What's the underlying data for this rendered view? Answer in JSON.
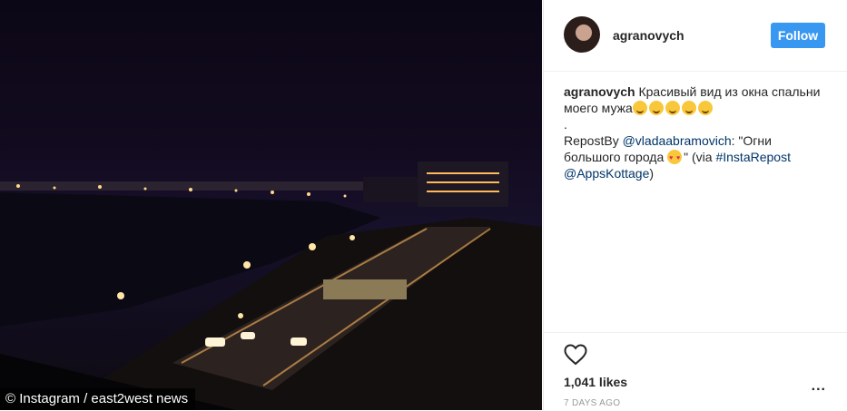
{
  "photo": {
    "credit": "© Instagram / east2west news"
  },
  "post": {
    "username": "agranovych",
    "follow_label": "Follow",
    "caption": {
      "author": "agranovych",
      "text_line1": "Красивый вид из окна спальни моего мужа",
      "dot": ".",
      "repost_prefix": "RepostBy",
      "repost_user": "@vladaabramovich",
      "repost_quote": ": \"Огни большого города",
      "via_prefix": "\" (via",
      "hashtag": "#InstaRepost",
      "apps_user": "@AppsKottage",
      "close": ")"
    },
    "likes": "1,041 likes",
    "time_ago": "7 DAYS AGO",
    "more_label": "..."
  },
  "icons": {
    "heart": "heart-icon",
    "more": "more-options-icon"
  },
  "colors": {
    "follow_bg": "#3897f0",
    "link": "#003569"
  }
}
